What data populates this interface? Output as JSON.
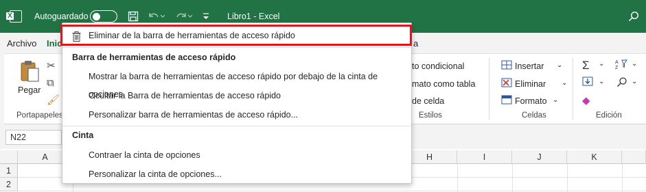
{
  "titlebar": {
    "autosave_label": "Autoguardado",
    "doc_title": "Libro1  -  Excel",
    "qat_icons": [
      "save-icon",
      "undo-icon",
      "redo-icon",
      "customize-qat-icon"
    ]
  },
  "tabs": [
    "Archivo",
    "Inic",
    "a"
  ],
  "ribbon": {
    "paste_label": "Pegar",
    "clipboard_group": "Portapapeles",
    "styles": {
      "cond_format": "to condicional",
      "format_table": "mato como tabla",
      "cell_styles": "de celda",
      "group": "Estilos"
    },
    "cells": {
      "insert": "Insertar",
      "delete": "Eliminar",
      "format": "Formato",
      "group": "Celdas"
    },
    "editing_group": "Edición"
  },
  "namebox": "N22",
  "columns": [
    "A",
    "H",
    "I",
    "J",
    "K"
  ],
  "rows": [
    "1",
    "2"
  ],
  "menu": {
    "remove_item": "Eliminar de la barra de herramientas de acceso rápido",
    "section_qat": "Barra de herramientas de acceso rápido",
    "qat_items": [
      "Mostrar la barra de herramientas de acceso rápido por debajo de la cinta de opciones",
      "Ocultar la Barra de herramientas de acceso rápido",
      "Personalizar barra de herramientas de acceso rápido..."
    ],
    "section_ribbon": "Cinta",
    "ribbon_items": [
      "Contraer la cinta de opciones",
      "Personalizar la cinta de opciones..."
    ]
  },
  "colors": {
    "excel_green": "#217346",
    "highlight_red": "#e0161c"
  }
}
